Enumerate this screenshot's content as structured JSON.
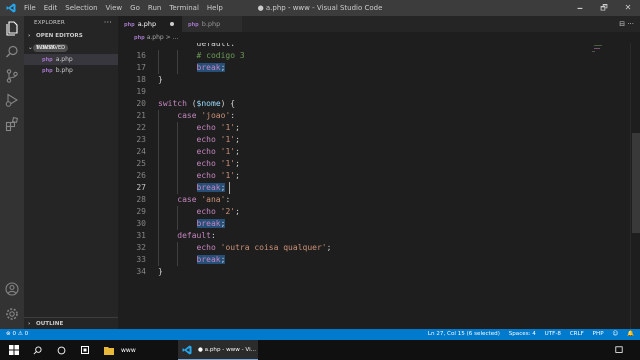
{
  "window": {
    "title": "● a.php - www - Visual Studio Code"
  },
  "menu": [
    "File",
    "Edit",
    "Selection",
    "View",
    "Go",
    "Run",
    "Terminal",
    "Help"
  ],
  "window_controls": {
    "minimize": "🗕",
    "restore": "🗗",
    "close": "✕"
  },
  "sidebar": {
    "title": "EXPLORER",
    "more": "···",
    "open_editors": {
      "label": "OPEN EDITORS",
      "badge": "1 UNSAVED"
    },
    "folder": "WWW",
    "files": [
      {
        "icon": "php",
        "name": "a.php"
      },
      {
        "icon": "php",
        "name": "b.php"
      }
    ],
    "outline": "OUTLINE"
  },
  "tabs": [
    {
      "icon": "php",
      "label": "a.php",
      "dirty": true
    },
    {
      "icon": "php",
      "label": "b.php",
      "dirty": false
    }
  ],
  "tab_actions": "⊟ ···",
  "breadcrumb": {
    "icon": "php",
    "file": "a.php",
    "sep": ">",
    "tail": "..."
  },
  "editor": {
    "current_line": 27,
    "lines": [
      {
        "n": "",
        "tokens": [
          {
            "t": "        default:",
            "c": ""
          }
        ]
      },
      {
        "n": "16",
        "tokens": [
          {
            "t": "        ",
            "c": ""
          },
          {
            "t": "# codigo 3",
            "c": "cmt"
          }
        ]
      },
      {
        "n": "17",
        "tokens": [
          {
            "t": "        ",
            "c": ""
          },
          {
            "t": "break",
            "c": "kw hl"
          },
          {
            "t": ";",
            "c": "hl"
          }
        ]
      },
      {
        "n": "18",
        "tokens": [
          {
            "t": "}",
            "c": ""
          }
        ]
      },
      {
        "n": "19",
        "tokens": []
      },
      {
        "n": "20",
        "tokens": [
          {
            "t": "switch",
            "c": "kw"
          },
          {
            "t": " (",
            "c": ""
          },
          {
            "t": "$nome",
            "c": "var"
          },
          {
            "t": ") {",
            "c": ""
          }
        ]
      },
      {
        "n": "21",
        "tokens": [
          {
            "t": "    ",
            "c": ""
          },
          {
            "t": "case",
            "c": "kw"
          },
          {
            "t": " ",
            "c": ""
          },
          {
            "t": "'joao'",
            "c": "str"
          },
          {
            "t": ":",
            "c": ""
          }
        ]
      },
      {
        "n": "22",
        "tokens": [
          {
            "t": "        ",
            "c": ""
          },
          {
            "t": "echo",
            "c": "kw"
          },
          {
            "t": " ",
            "c": ""
          },
          {
            "t": "'1'",
            "c": "str"
          },
          {
            "t": ";",
            "c": ""
          }
        ]
      },
      {
        "n": "23",
        "tokens": [
          {
            "t": "        ",
            "c": ""
          },
          {
            "t": "echo",
            "c": "kw"
          },
          {
            "t": " ",
            "c": ""
          },
          {
            "t": "'1'",
            "c": "str"
          },
          {
            "t": ";",
            "c": ""
          }
        ]
      },
      {
        "n": "24",
        "tokens": [
          {
            "t": "        ",
            "c": ""
          },
          {
            "t": "echo",
            "c": "kw"
          },
          {
            "t": " ",
            "c": ""
          },
          {
            "t": "'1'",
            "c": "str"
          },
          {
            "t": ";",
            "c": ""
          }
        ]
      },
      {
        "n": "25",
        "tokens": [
          {
            "t": "        ",
            "c": ""
          },
          {
            "t": "echo",
            "c": "kw"
          },
          {
            "t": " ",
            "c": ""
          },
          {
            "t": "'1'",
            "c": "str"
          },
          {
            "t": ";",
            "c": ""
          }
        ]
      },
      {
        "n": "26",
        "tokens": [
          {
            "t": "        ",
            "c": ""
          },
          {
            "t": "echo",
            "c": "kw"
          },
          {
            "t": " ",
            "c": ""
          },
          {
            "t": "'1'",
            "c": "str"
          },
          {
            "t": ";",
            "c": ""
          }
        ]
      },
      {
        "n": "27",
        "tokens": [
          {
            "t": "        ",
            "c": ""
          },
          {
            "t": "break",
            "c": "kw hl"
          },
          {
            "t": ";",
            "c": "hl"
          }
        ]
      },
      {
        "n": "28",
        "tokens": [
          {
            "t": "    ",
            "c": ""
          },
          {
            "t": "case",
            "c": "kw"
          },
          {
            "t": " ",
            "c": ""
          },
          {
            "t": "'ana'",
            "c": "str"
          },
          {
            "t": ":",
            "c": ""
          }
        ]
      },
      {
        "n": "29",
        "tokens": [
          {
            "t": "        ",
            "c": ""
          },
          {
            "t": "echo",
            "c": "kw"
          },
          {
            "t": " ",
            "c": ""
          },
          {
            "t": "'2'",
            "c": "str"
          },
          {
            "t": ";",
            "c": ""
          }
        ]
      },
      {
        "n": "30",
        "tokens": [
          {
            "t": "        ",
            "c": ""
          },
          {
            "t": "break",
            "c": "kw hl"
          },
          {
            "t": ";",
            "c": "hl"
          }
        ]
      },
      {
        "n": "31",
        "tokens": [
          {
            "t": "    ",
            "c": ""
          },
          {
            "t": "default",
            "c": "kw"
          },
          {
            "t": ":",
            "c": ""
          }
        ]
      },
      {
        "n": "32",
        "tokens": [
          {
            "t": "        ",
            "c": ""
          },
          {
            "t": "echo",
            "c": "kw"
          },
          {
            "t": " ",
            "c": ""
          },
          {
            "t": "'outra coisa qualquer'",
            "c": "str"
          },
          {
            "t": ";",
            "c": ""
          }
        ]
      },
      {
        "n": "33",
        "tokens": [
          {
            "t": "        ",
            "c": ""
          },
          {
            "t": "break",
            "c": "kw hl"
          },
          {
            "t": ";",
            "c": "hl"
          }
        ]
      },
      {
        "n": "34",
        "tokens": [
          {
            "t": "}",
            "c": ""
          }
        ]
      }
    ]
  },
  "statusbar": {
    "problems": "⊗ 0 ⚠ 0",
    "items": [
      "Ln 27, Col 15 (6 selected)",
      "Spaces: 4",
      "UTF-8",
      "CRLF",
      "PHP"
    ]
  },
  "taskbar": {
    "folder_label": "www",
    "vscode_label": "● a.php - www - Vi..."
  },
  "colors": {
    "accent": "#007acc",
    "php_icon": "#a074c4",
    "keyword": "#c586c0",
    "string": "#ce9178",
    "comment": "#6a9955",
    "variable": "#9cdcfe"
  }
}
